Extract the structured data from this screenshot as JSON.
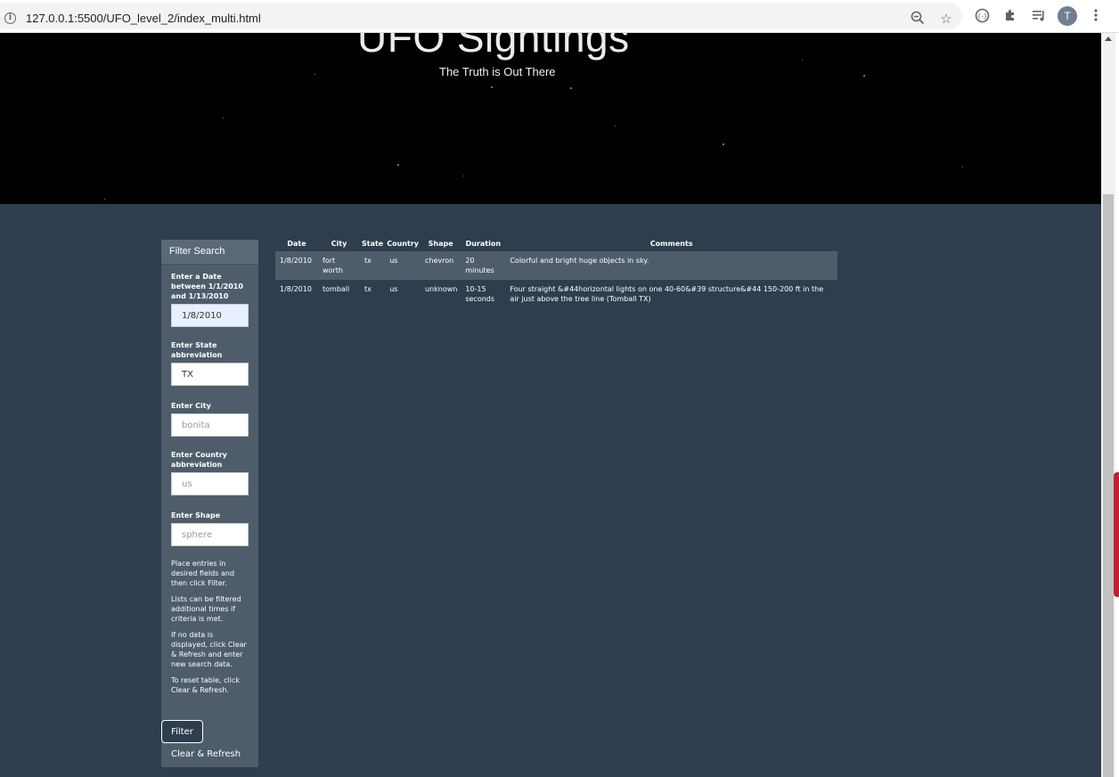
{
  "browser": {
    "url_host": "127.0.0.1",
    "url_path": ":5500/UFO_level_2/index_multi.html",
    "avatar_initial": "T",
    "icons": [
      "info-icon",
      "zoom-out-icon",
      "star-icon",
      "extension-circle-icon",
      "puzzle-icon",
      "media-queue-icon",
      "kebab-menu-icon"
    ]
  },
  "hero": {
    "title": "UFO Sightings",
    "subtitle": "The Truth is Out There"
  },
  "filter": {
    "header": "Filter Search",
    "fields": [
      {
        "label": "Enter a Date between 1/1/2010 and 1/13/2010",
        "value": "1/8/2010",
        "placeholder": ""
      },
      {
        "label": "Enter State abbreviation",
        "value": "TX",
        "placeholder": ""
      },
      {
        "label": "Enter City",
        "value": "",
        "placeholder": "bonita"
      },
      {
        "label": "Enter Country abbreviation",
        "value": "",
        "placeholder": "us"
      },
      {
        "label": "Enter Shape",
        "value": "",
        "placeholder": "sphere"
      }
    ],
    "notes": [
      "Place entries in desired fields and then click Filter.",
      "Lists can be filtered additional times if criteria is met.",
      "If no data is displayed, click Clear & Refresh and enter new search data.",
      "To reset table, click Clear & Refresh."
    ],
    "filter_button": "Filter",
    "clear_button": "Clear & Refresh"
  },
  "table": {
    "headers": [
      "Date",
      "City",
      "State",
      "Country",
      "Shape",
      "Duration",
      "Comments"
    ],
    "rows": [
      [
        "1/8/2010",
        "fort worth",
        "tx",
        "us",
        "chevron",
        "20 minutes",
        "Colorful and bright huge objects in sky."
      ],
      [
        "1/8/2010",
        "tomball",
        "tx",
        "us",
        "unknown",
        "10-15 seconds",
        "Four straight &#44horizontal lights on one 40-60&#39 structure&#44 150-200 ft in the air just above the tree line (Tomball TX)"
      ]
    ]
  },
  "colors": {
    "page_bg": "#2e3e4f",
    "panel_bg": "#4f5d6b",
    "hero_bg": "#000000",
    "accent_star": "#8a8fd8"
  }
}
